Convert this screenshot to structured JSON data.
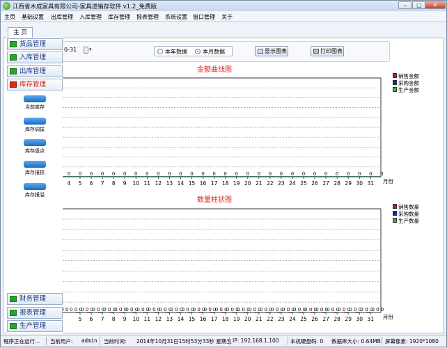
{
  "window": {
    "title": "江西省木成家具有限公司-家具进销存软件 v1.2_免费版",
    "min_glyph": "–",
    "max_glyph": "□",
    "close_glyph": "✕"
  },
  "menu": [
    "主页",
    "基础设置",
    "出库管理",
    "入库管理",
    "库存管理",
    "报表管理",
    "系统设置",
    "窗口管理",
    "关于"
  ],
  "tabs": [
    "主 页"
  ],
  "toolbar": {
    "date_suffix": "0-31",
    "radio_year": "本年数据",
    "radio_month": "本月数据",
    "selected": "本月数据",
    "show_chart_label": "显示图表",
    "print_chart_label": "打印图表"
  },
  "sidebar": {
    "top_sections": [
      {
        "label": "货品管理",
        "active": false
      },
      {
        "label": "入库管理",
        "active": false
      },
      {
        "label": "出库管理",
        "active": false
      },
      {
        "label": "库存管理",
        "active": true
      }
    ],
    "active_items": [
      "当前库存",
      "库存调拔",
      "库存盘点",
      "库存报损",
      "库存报溢"
    ],
    "bottom_sections": [
      {
        "label": "财务管理"
      },
      {
        "label": "报表管理"
      },
      {
        "label": "生产管理"
      }
    ]
  },
  "chart_data": [
    {
      "type": "line",
      "title": "金额曲线图",
      "xlabel": "月份",
      "x_partial_label": "4",
      "categories": [
        "5",
        "6",
        "7",
        "8",
        "9",
        "10",
        "11",
        "12",
        "13",
        "14",
        "15",
        "16",
        "17",
        "18",
        "19",
        "20",
        "21",
        "22",
        "23",
        "24",
        "25",
        "26",
        "27",
        "28",
        "29",
        "30",
        "31"
      ],
      "series": [
        {
          "name": "销售金额",
          "color": "#e01010"
        },
        {
          "name": "采购金额",
          "color": "#1a1ad8"
        },
        {
          "name": "生产金额",
          "color": "#20c020"
        }
      ],
      "value_labels": [
        "0",
        "0",
        "0",
        "0",
        "0",
        "0",
        "0",
        "0",
        "0",
        "0",
        "0",
        "0",
        "0",
        "0",
        "0",
        "0",
        "0",
        "0",
        "0",
        "0",
        "0",
        "0",
        "0",
        "0",
        "0",
        "0",
        "0",
        "0",
        "0"
      ],
      "legend": "top-right",
      "grid": true
    },
    {
      "type": "bar",
      "title": "数量柱状图",
      "xlabel": "月份",
      "x_partial_label": "",
      "categories": [
        "5",
        "6",
        "7",
        "8",
        "9",
        "10",
        "11",
        "12",
        "13",
        "14",
        "15",
        "16",
        "17",
        "18",
        "19",
        "20",
        "21",
        "22",
        "23",
        "24",
        "25",
        "26",
        "27",
        "28",
        "29",
        "30",
        "31"
      ],
      "series": [
        {
          "name": "销售数量",
          "color": "#e01010"
        },
        {
          "name": "采购数量",
          "color": "#1a1ad8"
        },
        {
          "name": "生产数量",
          "color": "#20c020"
        }
      ],
      "value_labels": [
        "0 0",
        "0 0 0",
        "0 0 0",
        "0 0 0",
        "0 0 0",
        "0 0 0",
        "0 0 0",
        "0 0 0",
        "0 0 0",
        "0 0 0",
        "0 0 0",
        "0 0 0",
        "0 0 0",
        "0 0 0",
        "0 0 0",
        "0 0 0",
        "0 0 0",
        "0 0 0",
        "0 0 0",
        "0 0 0",
        "0 0 0",
        "0 0 0",
        "0 0 0",
        "0 0 0",
        "0 0 0",
        "0 0 0",
        "0 0 0",
        "0 0 0",
        "0 0 0"
      ],
      "legend": "top-right",
      "grid": true
    }
  ],
  "status": {
    "running": "程序正在运行...",
    "user_label": "当前用户:",
    "user": "admin",
    "time_label": "当前时间:",
    "time": "2014年10月31日15时53分33秒 星期五",
    "ip_label": "IP: 192.168.1.100",
    "disk_label": "本机硬盘码: 0",
    "db_label": "数据库大小: 0.64MB",
    "screen_label": "屏幕像素: 1920*1080"
  }
}
